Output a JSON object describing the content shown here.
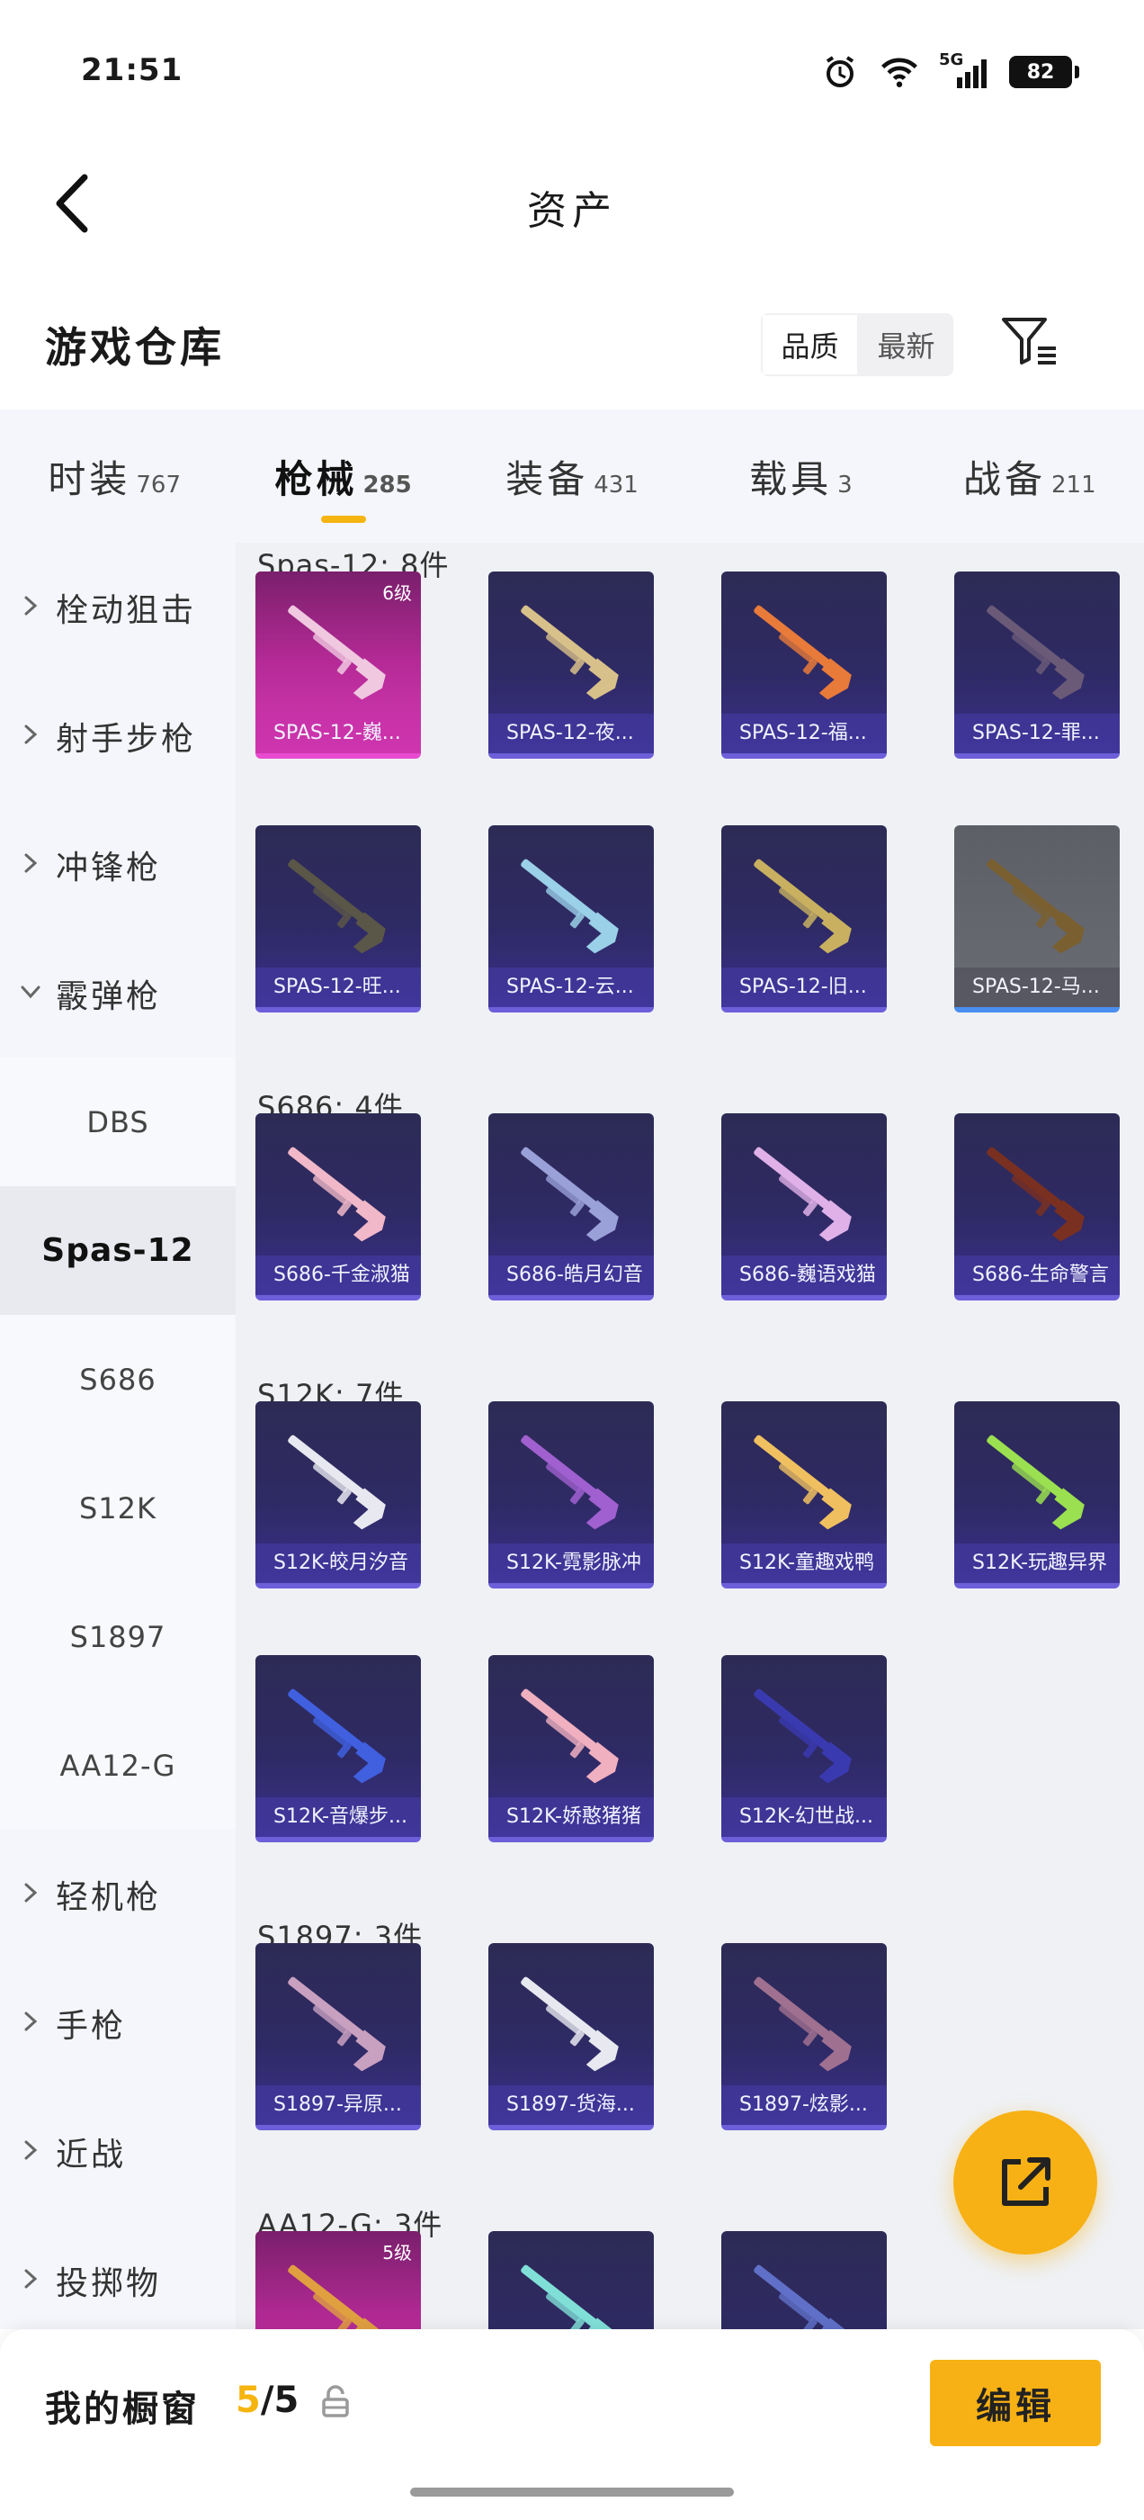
{
  "status_bar": {
    "time": "21:51",
    "network": "5G",
    "battery": "82"
  },
  "header": {
    "title": "资产"
  },
  "library": {
    "title": "游戏仓库",
    "sort_quality": "品质",
    "sort_latest": "最新"
  },
  "tabs": [
    {
      "label": "时装",
      "count": "767",
      "active": false
    },
    {
      "label": "枪械",
      "count": "285",
      "active": true
    },
    {
      "label": "装备",
      "count": "431",
      "active": false
    },
    {
      "label": "载具",
      "count": "3",
      "active": false
    },
    {
      "label": "战备",
      "count": "211",
      "active": false
    }
  ],
  "sidebar": [
    {
      "label": "栓动狙击",
      "type": "cat",
      "expanded": false
    },
    {
      "label": "射手步枪",
      "type": "cat",
      "expanded": false
    },
    {
      "label": "冲锋枪",
      "type": "cat",
      "expanded": false
    },
    {
      "label": "霰弹枪",
      "type": "cat",
      "expanded": true
    },
    {
      "label": "DBS",
      "type": "sub"
    },
    {
      "label": "Spas-12",
      "type": "sub",
      "active": true
    },
    {
      "label": "S686",
      "type": "sub"
    },
    {
      "label": "S12K",
      "type": "sub"
    },
    {
      "label": "S1897",
      "type": "sub"
    },
    {
      "label": "AA12-G",
      "type": "sub"
    },
    {
      "label": "轻机枪",
      "type": "cat",
      "expanded": false
    },
    {
      "label": "手枪",
      "type": "cat",
      "expanded": false
    },
    {
      "label": "近战",
      "type": "cat",
      "expanded": false
    },
    {
      "label": "投掷物",
      "type": "cat",
      "expanded": false
    }
  ],
  "sections": [
    {
      "title": "Spas-12: 8件",
      "items": [
        {
          "label": "SPAS-12-巍...",
          "style": "pink",
          "level": "6级",
          "gun": "#f0c8e0"
        },
        {
          "label": "SPAS-12-夜...",
          "style": "purple",
          "gun": "#d8c08a"
        },
        {
          "label": "SPAS-12-福...",
          "style": "purple",
          "gun": "#e87a3a"
        },
        {
          "label": "SPAS-12-罪...",
          "style": "purple",
          "gun": "#6a5a78"
        },
        {
          "label": "SPAS-12-旺...",
          "style": "purple",
          "gun": "#5a5648"
        },
        {
          "label": "SPAS-12-云...",
          "style": "purple",
          "gun": "#9ad0e8"
        },
        {
          "label": "SPAS-12-旧...",
          "style": "purple",
          "gun": "#c8b060"
        },
        {
          "label": "SPAS-12-马...",
          "style": "gray",
          "gun": "#7a6030"
        }
      ]
    },
    {
      "title": "S686: 4件",
      "items": [
        {
          "label": "S686-千金淑猫",
          "style": "purple",
          "gun": "#f0b8c8"
        },
        {
          "label": "S686-皓月幻音",
          "style": "purple",
          "gun": "#9aa0d8"
        },
        {
          "label": "S686-巍语戏猫",
          "style": "purple",
          "gun": "#e0b0e8"
        },
        {
          "label": "S686-生命警言",
          "style": "purple",
          "gun": "#7a3020"
        }
      ]
    },
    {
      "title": "S12K: 7件",
      "items": [
        {
          "label": "S12K-皎月汐音",
          "style": "purple",
          "gun": "#e8e8f0"
        },
        {
          "label": "S12K-霓影脉冲",
          "style": "purple",
          "gun": "#a060d0"
        },
        {
          "label": "S12K-童趣戏鸭",
          "style": "purple",
          "gun": "#f0c060"
        },
        {
          "label": "S12K-玩趣异界",
          "style": "purple",
          "gun": "#9ae050"
        },
        {
          "label": "S12K-音爆步...",
          "style": "purple",
          "gun": "#4060e0"
        },
        {
          "label": "S12K-娇憨猪猪",
          "style": "purple",
          "gun": "#f0b0c0"
        },
        {
          "label": "S12K-幻世战...",
          "style": "purple",
          "gun": "#3a3ab0"
        }
      ]
    },
    {
      "title": "S1897: 3件",
      "items": [
        {
          "label": "S1897-异原...",
          "style": "purple",
          "gun": "#c8a0c0"
        },
        {
          "label": "S1897-货海...",
          "style": "purple",
          "gun": "#e8e8f0"
        },
        {
          "label": "S1897-炫影...",
          "style": "purple",
          "gun": "#a07090"
        }
      ]
    },
    {
      "title": "AA12-G: 3件",
      "items": [
        {
          "label": "",
          "style": "pink",
          "level": "5级",
          "gun": "#e0a040"
        },
        {
          "label": "",
          "style": "purple",
          "gun": "#80e0d8"
        },
        {
          "label": "",
          "style": "purple",
          "gun": "#6070c8"
        }
      ]
    }
  ],
  "showcase": {
    "label": "我的橱窗",
    "current": "5",
    "total": "/5"
  },
  "edit_button": "编辑",
  "colors": {
    "accent": "#f7b114",
    "tab_indicator": "#f5b40f"
  }
}
